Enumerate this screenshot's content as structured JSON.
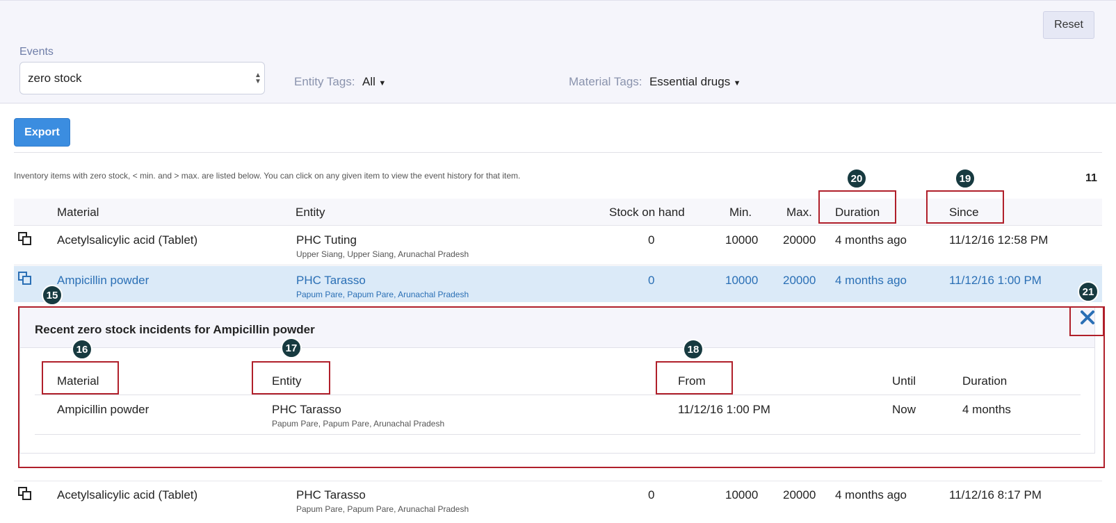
{
  "filters": {
    "reset_label": "Reset",
    "events_label": "Events",
    "events_value": "zero stock",
    "entity_tags_label": "Entity Tags:",
    "entity_tags_value": "All",
    "material_tags_label": "Material Tags:",
    "material_tags_value": "Essential drugs"
  },
  "toolbar": {
    "export_label": "Export"
  },
  "list": {
    "info_text": "Inventory items with zero stock, < min. and > max. are listed below. You can click on any given item to view the event history for that item.",
    "count": "11",
    "headers": [
      "Material",
      "Entity",
      "Stock on hand",
      "Min.",
      "Max.",
      "Duration",
      "Since"
    ],
    "rows": [
      {
        "material": "Acetylsalicylic acid (Tablet)",
        "entity": "PHC Tuting",
        "location": "Upper Siang, Upper Siang, Arunachal Pradesh",
        "stock": "0",
        "min": "10000",
        "max": "20000",
        "duration": "4 months ago",
        "since": "11/12/16 12:58 PM"
      },
      {
        "material": "Ampicillin powder",
        "entity": "PHC Tarasso",
        "location": "Papum Pare, Papum Pare, Arunachal Pradesh",
        "stock": "0",
        "min": "10000",
        "max": "20000",
        "duration": "4 months ago",
        "since": "11/12/16 1:00 PM"
      },
      {
        "material": "Acetylsalicylic acid (Tablet)",
        "entity": "PHC Tarasso",
        "location": "Papum Pare, Papum Pare, Arunachal Pradesh",
        "stock": "0",
        "min": "10000",
        "max": "20000",
        "duration": "4 months ago",
        "since": "11/12/16 8:17 PM"
      }
    ]
  },
  "detail": {
    "title": "Recent  zero stock  incidents for Ampicillin powder",
    "headers": [
      "Material",
      "Entity",
      "From",
      "Until",
      "Duration"
    ],
    "row": {
      "material": "Ampicillin powder",
      "entity": "PHC Tarasso",
      "location": "Papum Pare, Papum Pare, Arunachal Pradesh",
      "from": "11/12/16 1:00 PM",
      "until": "Now",
      "duration": "4 months"
    }
  },
  "callouts": {
    "c15": "15",
    "c16": "16",
    "c17": "17",
    "c18": "18",
    "c19": "19",
    "c20": "20",
    "c21": "21"
  },
  "colors": {
    "accent": "#3b8de0",
    "highlight": "#dbeaf8",
    "annotation": "#b01f2a",
    "callout": "#173a40"
  }
}
